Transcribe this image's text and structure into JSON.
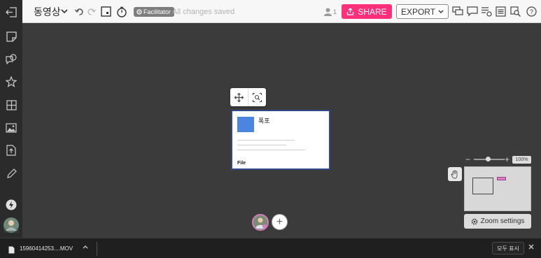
{
  "topbar": {
    "board_title": "동영상",
    "facilitator_label": "Facilitator",
    "save_status": "All changes saved",
    "users_online": "1",
    "share_label": "SHARE",
    "export_label": "EXPORT",
    "icons": [
      "chevron-down-icon",
      "undo-icon",
      "redo-icon",
      "card-icon",
      "timer-icon",
      "chat-icon",
      "comment-icon",
      "activity-icon",
      "list-icon",
      "search-icon",
      "help-icon"
    ]
  },
  "sidebar": {
    "items": [
      {
        "icon": "exit-icon"
      },
      {
        "icon": "sticky-note-icon"
      },
      {
        "icon": "shapes-icon"
      },
      {
        "icon": "star-icon"
      },
      {
        "icon": "grid-icon"
      },
      {
        "icon": "image-icon"
      },
      {
        "icon": "upload-icon"
      },
      {
        "icon": "pencil-icon"
      },
      {
        "icon": "lightning-icon"
      },
      {
        "icon": "avatar"
      }
    ]
  },
  "canvas": {
    "file_card": {
      "file_name": "폭포",
      "type_label": "File"
    },
    "add_label": "+",
    "zoom_level": "100%",
    "zoom_value": 0.45,
    "zoom_settings_label": "Zoom settings"
  },
  "downloads": {
    "file_name": "15960414253....MOV",
    "show_all_label": "모두 표시"
  },
  "colors": {
    "share": "#ff2f7a",
    "file_thumb": "#4a86e0",
    "selection": "#2f4a88"
  }
}
